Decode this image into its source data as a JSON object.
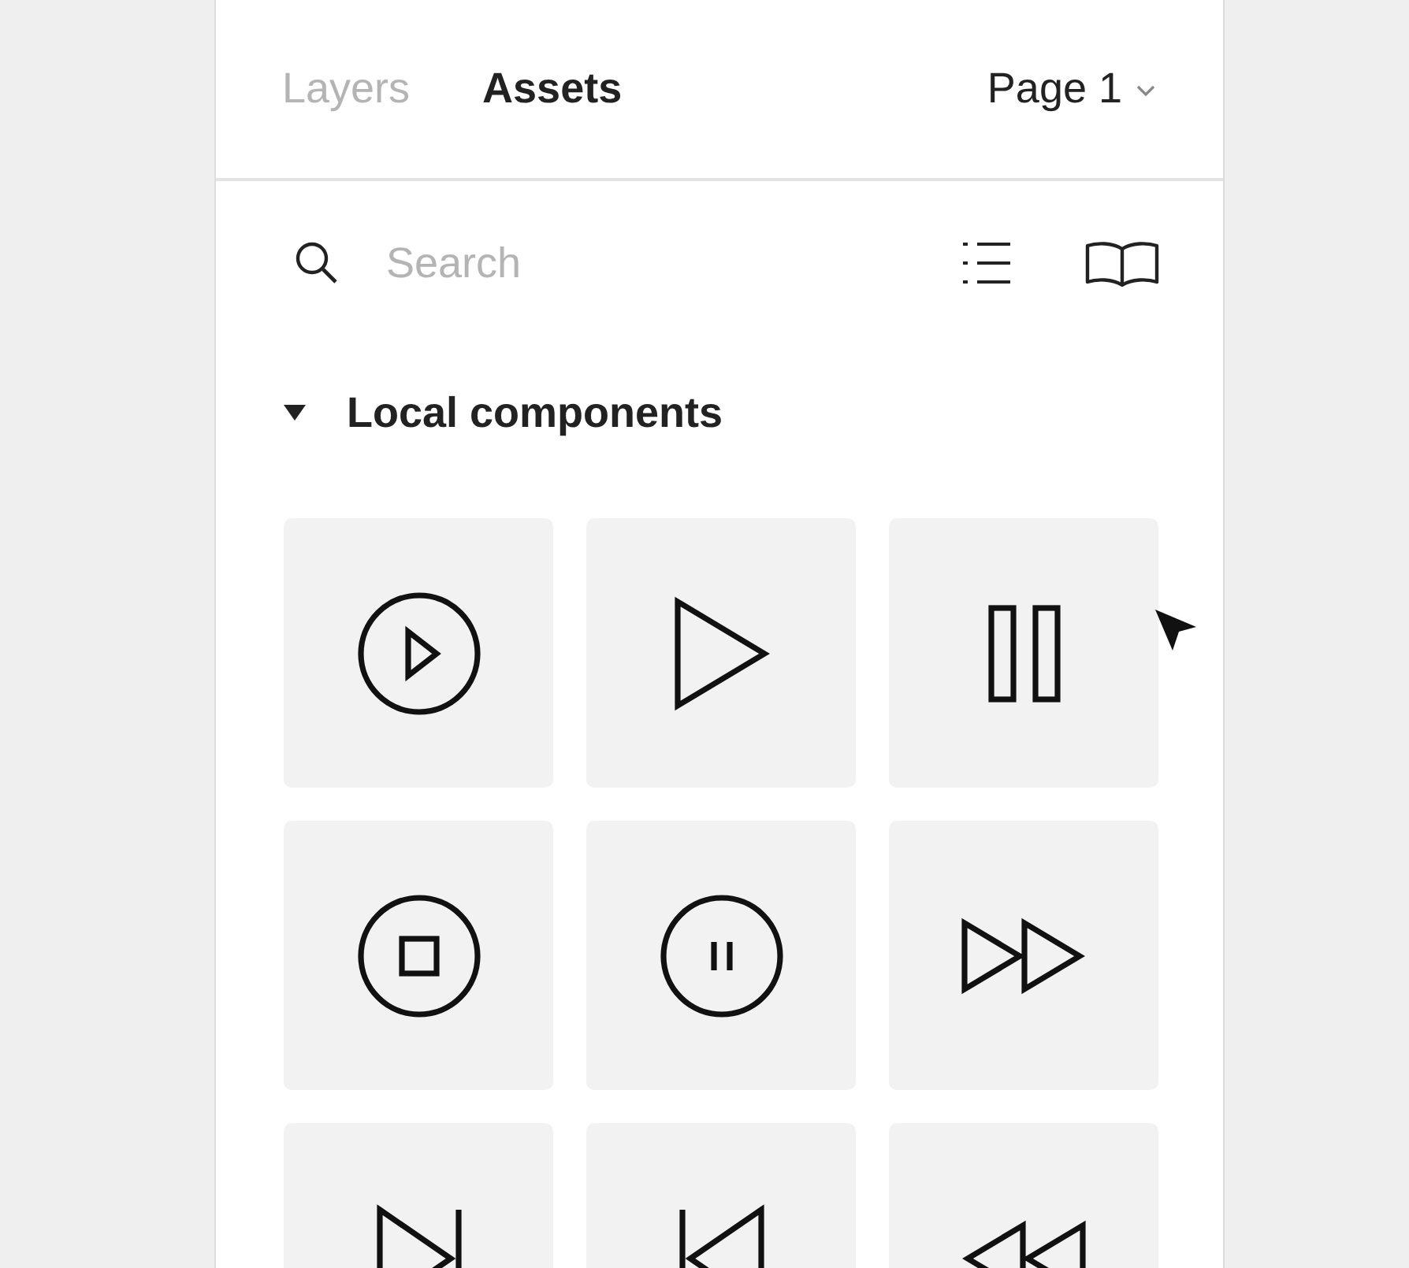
{
  "tabs": [
    {
      "label": "Layers",
      "selected": false
    },
    {
      "label": "Assets",
      "selected": true
    }
  ],
  "page_selector": {
    "label": "Page 1"
  },
  "search": {
    "placeholder": "Search"
  },
  "section": {
    "title": "Local components",
    "expanded": true
  },
  "components": [
    {
      "kind": "play-circle"
    },
    {
      "kind": "play"
    },
    {
      "kind": "pause"
    },
    {
      "kind": "stop-circle"
    },
    {
      "kind": "pause-circle"
    },
    {
      "kind": "fast-forward"
    },
    {
      "kind": "skip-next"
    },
    {
      "kind": "skip-previous"
    },
    {
      "kind": "rewind"
    }
  ]
}
